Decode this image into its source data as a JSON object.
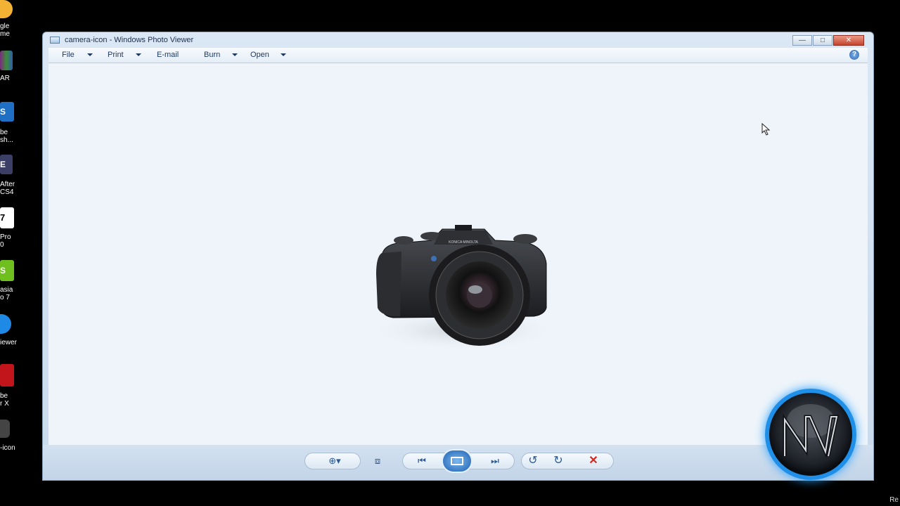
{
  "desktop": {
    "icons": [
      {
        "label_line1": "gle",
        "label_line2": "me",
        "color": "#f2b233"
      },
      {
        "label_line1": "AR",
        "label_line2": "",
        "color": "#7b2a7f"
      },
      {
        "label_line1": "be",
        "label_line2": "sh...",
        "color": "#1f6fc4"
      },
      {
        "label_line1": "After",
        "label_line2": "CS4",
        "color": "#3b3f66"
      },
      {
        "label_line1": "Pro",
        "label_line2": "0",
        "color": "#ffffff"
      },
      {
        "label_line1": "asia",
        "label_line2": "o 7",
        "color": "#6fbf1f"
      },
      {
        "label_line1": "iewer",
        "label_line2": "",
        "color": "#1e8ae6"
      },
      {
        "label_line1": "be",
        "label_line2": "r X",
        "color": "#c2141b"
      },
      {
        "label_line1": "-icon",
        "label_line2": "",
        "color": "#444444"
      }
    ],
    "corner_text": "Re"
  },
  "window": {
    "title": "camera-icon - Windows Photo Viewer",
    "minimize": "—",
    "maximize": "□",
    "close": "✕",
    "menu": {
      "file": "File",
      "print": "Print",
      "email": "E-mail",
      "burn": "Burn",
      "open": "Open"
    },
    "help": "?",
    "image_name": "camera-icon",
    "camera_brand": "KONICA MINOLTA"
  },
  "toolbar": {
    "zoom_icon": "magnifier-icon",
    "actual_size_icon": "fit-window-icon",
    "previous_icon": "previous-icon",
    "slideshow_icon": "slideshow-icon",
    "next_icon": "next-icon",
    "rotate_ccw_icon": "rotate-left-icon",
    "rotate_cw_icon": "rotate-right-icon",
    "delete_icon": "delete-icon"
  },
  "colors": {
    "accent": "#2c5a94",
    "delete": "#d8261b",
    "badge_ring": "#1f8fe8"
  },
  "watermark": {
    "text": "NA"
  }
}
